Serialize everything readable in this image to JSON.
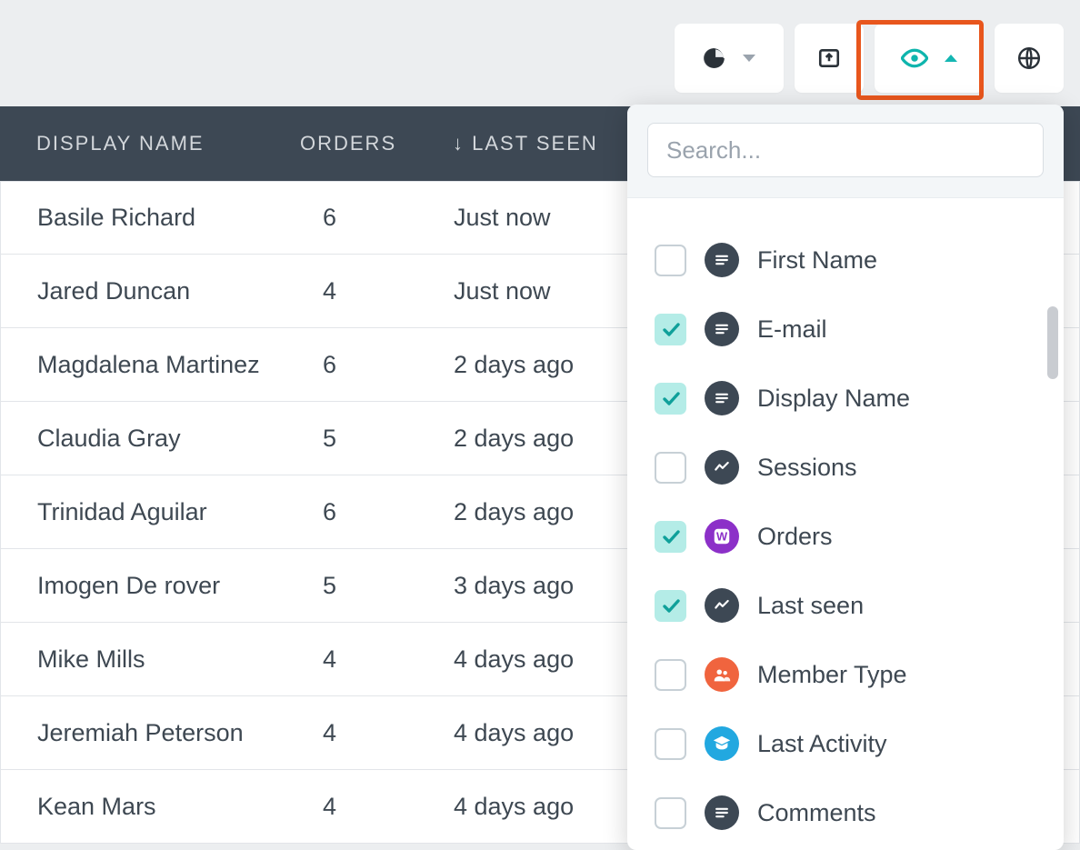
{
  "toolbar": {
    "chart_icon": "pie-chart-icon",
    "export_icon": "export-icon",
    "eye_icon": "eye-icon",
    "globe_icon": "globe-icon"
  },
  "table": {
    "headers": {
      "name": "DISPLAY NAME",
      "orders": "ORDERS",
      "last_seen": "LAST SEEN",
      "sort_indicator": "↓"
    },
    "rows": [
      {
        "name": "Basile Richard",
        "orders": "6",
        "last": "Just now"
      },
      {
        "name": "Jared Duncan",
        "orders": "4",
        "last": "Just now"
      },
      {
        "name": "Magdalena Martinez",
        "orders": "6",
        "last": "2 days ago"
      },
      {
        "name": "Claudia Gray",
        "orders": "5",
        "last": "2 days ago"
      },
      {
        "name": "Trinidad Aguilar",
        "orders": "6",
        "last": "2 days ago"
      },
      {
        "name": "Imogen De rover",
        "orders": "5",
        "last": "3 days ago"
      },
      {
        "name": "Mike Mills",
        "orders": "4",
        "last": "4 days ago"
      },
      {
        "name": "Jeremiah Peterson",
        "orders": "4",
        "last": "4 days ago"
      },
      {
        "name": "Kean Mars",
        "orders": "4",
        "last": "4 days ago"
      }
    ]
  },
  "panel": {
    "search_placeholder": "Search...",
    "options": [
      {
        "label": "First Name",
        "checked": false,
        "icon": "text",
        "color": "dark"
      },
      {
        "label": "E-mail",
        "checked": true,
        "icon": "text",
        "color": "dark"
      },
      {
        "label": "Display Name",
        "checked": true,
        "icon": "text",
        "color": "dark"
      },
      {
        "label": "Sessions",
        "checked": false,
        "icon": "trend",
        "color": "dark"
      },
      {
        "label": "Orders",
        "checked": true,
        "icon": "w",
        "color": "purple"
      },
      {
        "label": "Last seen",
        "checked": true,
        "icon": "trend",
        "color": "dark"
      },
      {
        "label": "Member Type",
        "checked": false,
        "icon": "people",
        "color": "orange"
      },
      {
        "label": "Last Activity",
        "checked": false,
        "icon": "cap",
        "color": "blue"
      },
      {
        "label": "Comments",
        "checked": false,
        "icon": "text",
        "color": "dark"
      }
    ]
  }
}
